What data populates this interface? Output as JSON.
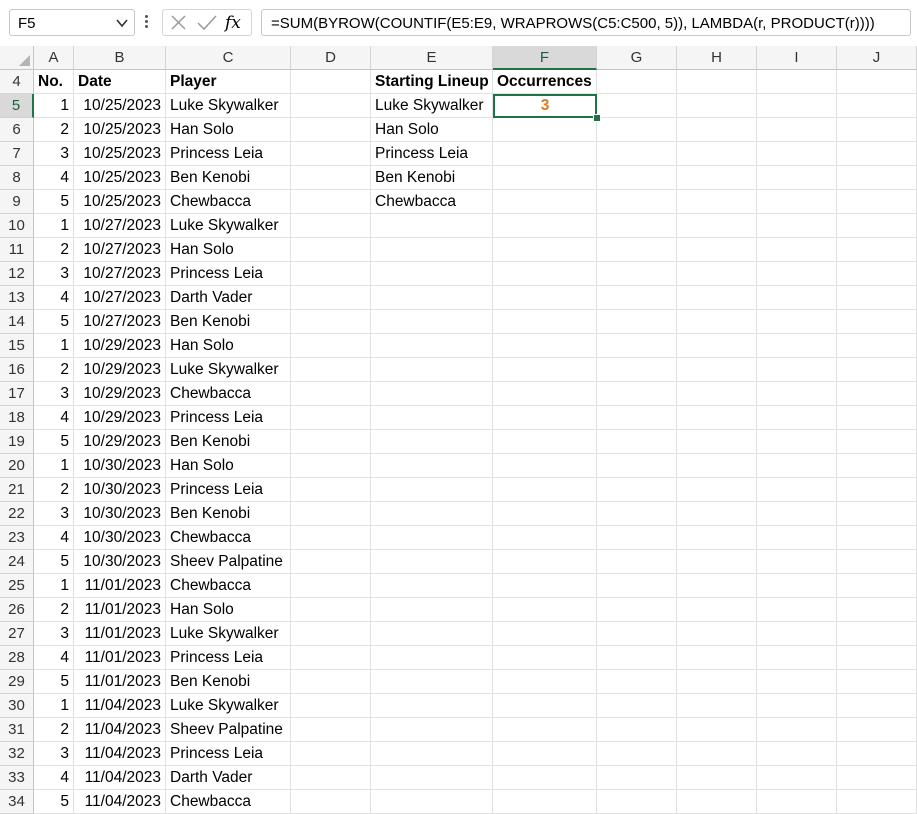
{
  "name_box": "F5",
  "formula": "=SUM(BYROW(COUNTIF(E5:E9, WRAPROWS(C5:C500, 5)), LAMBDA(r, PRODUCT(r))))",
  "fx_label": "fx",
  "columns": [
    "A",
    "B",
    "C",
    "D",
    "E",
    "F",
    "G",
    "H",
    "I",
    "J"
  ],
  "headers": {
    "no": "No.",
    "date": "Date",
    "player": "Player",
    "lineup": "Starting Lineup",
    "occurrences": "Occurrences"
  },
  "result": "3",
  "lineup": [
    "Luke Skywalker",
    "Han Solo",
    "Princess Leia",
    "Ben Kenobi",
    "Chewbacca"
  ],
  "rows": [
    {
      "n": "5",
      "no": "1",
      "date": "10/25/2023",
      "player": "Luke Skywalker"
    },
    {
      "n": "6",
      "no": "2",
      "date": "10/25/2023",
      "player": "Han Solo"
    },
    {
      "n": "7",
      "no": "3",
      "date": "10/25/2023",
      "player": "Princess Leia"
    },
    {
      "n": "8",
      "no": "4",
      "date": "10/25/2023",
      "player": "Ben Kenobi"
    },
    {
      "n": "9",
      "no": "5",
      "date": "10/25/2023",
      "player": "Chewbacca"
    },
    {
      "n": "10",
      "no": "1",
      "date": "10/27/2023",
      "player": "Luke Skywalker"
    },
    {
      "n": "11",
      "no": "2",
      "date": "10/27/2023",
      "player": "Han Solo"
    },
    {
      "n": "12",
      "no": "3",
      "date": "10/27/2023",
      "player": "Princess Leia"
    },
    {
      "n": "13",
      "no": "4",
      "date": "10/27/2023",
      "player": "Darth Vader"
    },
    {
      "n": "14",
      "no": "5",
      "date": "10/27/2023",
      "player": "Ben Kenobi"
    },
    {
      "n": "15",
      "no": "1",
      "date": "10/29/2023",
      "player": "Han Solo"
    },
    {
      "n": "16",
      "no": "2",
      "date": "10/29/2023",
      "player": "Luke Skywalker"
    },
    {
      "n": "17",
      "no": "3",
      "date": "10/29/2023",
      "player": "Chewbacca"
    },
    {
      "n": "18",
      "no": "4",
      "date": "10/29/2023",
      "player": "Princess Leia"
    },
    {
      "n": "19",
      "no": "5",
      "date": "10/29/2023",
      "player": "Ben Kenobi"
    },
    {
      "n": "20",
      "no": "1",
      "date": "10/30/2023",
      "player": "Han Solo"
    },
    {
      "n": "21",
      "no": "2",
      "date": "10/30/2023",
      "player": "Princess Leia"
    },
    {
      "n": "22",
      "no": "3",
      "date": "10/30/2023",
      "player": "Ben Kenobi"
    },
    {
      "n": "23",
      "no": "4",
      "date": "10/30/2023",
      "player": "Chewbacca"
    },
    {
      "n": "24",
      "no": "5",
      "date": "10/30/2023",
      "player": "Sheev Palpatine"
    },
    {
      "n": "25",
      "no": "1",
      "date": "11/01/2023",
      "player": "Chewbacca"
    },
    {
      "n": "26",
      "no": "2",
      "date": "11/01/2023",
      "player": "Han Solo"
    },
    {
      "n": "27",
      "no": "3",
      "date": "11/01/2023",
      "player": "Luke Skywalker"
    },
    {
      "n": "28",
      "no": "4",
      "date": "11/01/2023",
      "player": "Princess Leia"
    },
    {
      "n": "29",
      "no": "5",
      "date": "11/01/2023",
      "player": "Ben Kenobi"
    },
    {
      "n": "30",
      "no": "1",
      "date": "11/04/2023",
      "player": "Luke Skywalker"
    },
    {
      "n": "31",
      "no": "2",
      "date": "11/04/2023",
      "player": "Sheev Palpatine"
    },
    {
      "n": "32",
      "no": "3",
      "date": "11/04/2023",
      "player": "Princess Leia"
    },
    {
      "n": "33",
      "no": "4",
      "date": "11/04/2023",
      "player": "Darth Vader"
    },
    {
      "n": "34",
      "no": "5",
      "date": "11/04/2023",
      "player": "Chewbacca"
    }
  ],
  "header_row_number": "4",
  "colors": {
    "accent": "#217346",
    "result": "#e07b1f"
  }
}
